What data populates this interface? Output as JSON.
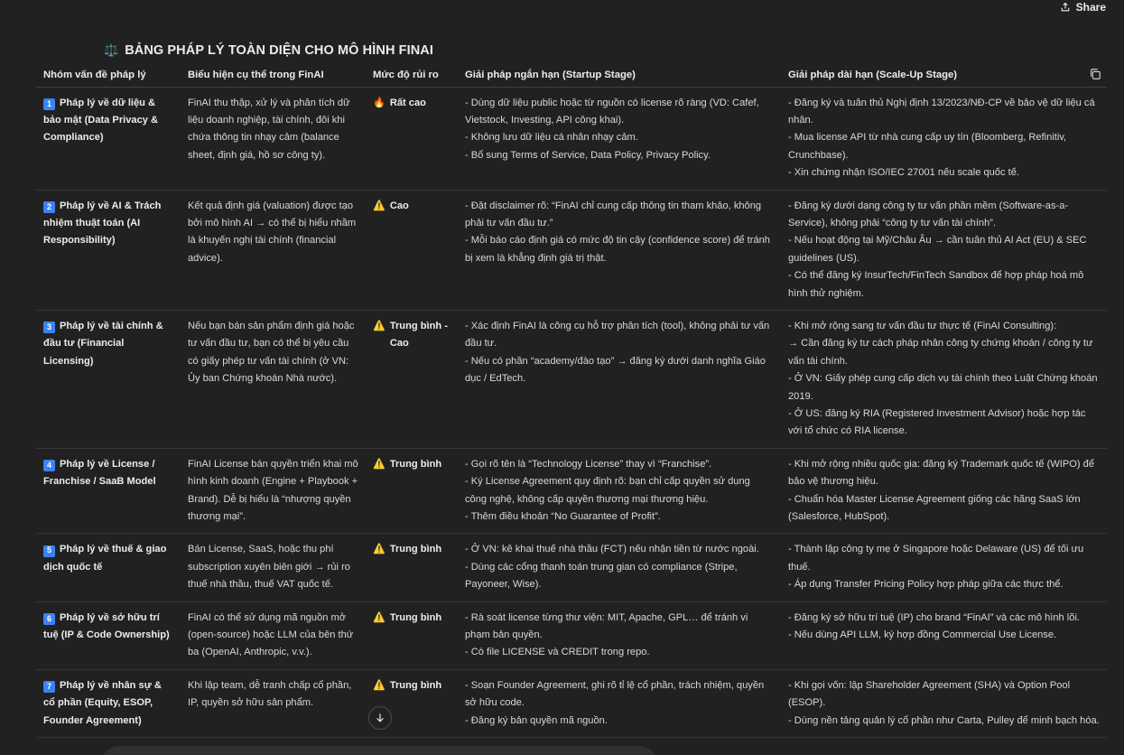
{
  "header": {
    "share_label": "Share"
  },
  "doc": {
    "title_icon": "⚖️",
    "title": "BẢNG PHÁP LÝ TOÀN DIỆN CHO MÔ HÌNH FINAI",
    "columns": [
      "Nhóm vấn đề pháp lý",
      "Biểu hiện cụ thể trong FinAI",
      "Mức độ rủi ro",
      "Giải pháp ngắn hạn (Startup Stage)",
      "Giải pháp dài hạn (Scale-Up Stage)"
    ],
    "rows": [
      {
        "num": "1",
        "issue": "Pháp lý về dữ liệu & bảo mật (Data Privacy & Compliance)",
        "desc": "FinAI thu thập, xử lý và phân tích dữ liệu doanh nghiệp, tài chính, đôi khi chứa thông tin nhạy cảm (balance sheet, định giá, hồ sơ công ty).",
        "risk_icon": "🔥",
        "risk": "Rất cao",
        "short": [
          "- Dùng dữ liệu public hoặc từ nguồn có license rõ ràng (VD: Cafef, Vietstock, Investing, API công khai).",
          "- Không lưu dữ liệu cá nhân nhạy cảm.",
          "- Bổ sung Terms of Service, Data Policy, Privacy Policy."
        ],
        "long": [
          "- Đăng ký và tuân thủ Nghị định 13/2023/NĐ-CP về bảo vệ dữ liệu cá nhân.",
          "- Mua license API từ nhà cung cấp uy tín (Bloomberg, Refinitiv, Crunchbase).",
          "- Xin chứng nhận ISO/IEC 27001 nếu scale quốc tế."
        ]
      },
      {
        "num": "2",
        "issue": "Pháp lý về AI & Trách nhiệm thuật toán (AI Responsibility)",
        "desc": "Kết quả định giá (valuation) được tạo bởi mô hình AI → có thể bị hiểu nhầm là khuyến nghị tài chính (financial advice).",
        "risk_icon": "⚠️",
        "risk": "Cao",
        "short": [
          "- Đặt disclaimer rõ: “FinAI chỉ cung cấp thông tin tham khảo, không phải tư vấn đầu tư.”",
          "- Mỗi báo cáo định giá có mức độ tin cậy (confidence score) để tránh bị xem là khẳng định giá trị thật."
        ],
        "long": [
          "- Đăng ký dưới dạng công ty tư vấn phần mềm (Software-as-a-Service), không phải “công ty tư vấn tài chính”.",
          "- Nếu hoạt động tại Mỹ/Châu Âu → cần tuân thủ AI Act (EU) & SEC guidelines (US).",
          "- Có thể đăng ký InsurTech/FinTech Sandbox để hợp pháp hoá mô hình thử nghiệm."
        ]
      },
      {
        "num": "3",
        "issue": "Pháp lý về tài chính & đầu tư (Financial Licensing)",
        "desc": "Nếu bạn bán sản phẩm định giá hoặc tư vấn đầu tư, bạn có thể bị yêu cầu có giấy phép tư vấn tài chính (ở VN: Ủy ban Chứng khoán Nhà nước).",
        "risk_icon": "⚠️",
        "risk": "Trung bình - Cao",
        "short": [
          "- Xác định FinAI là công cụ hỗ trợ phân tích (tool), không phải tư vấn đầu tư.",
          "- Nếu có phần “academy/đào tạo” → đăng ký dưới danh nghĩa Giáo dục / EdTech."
        ],
        "long": [
          "- Khi mở rộng sang tư vấn đầu tư thực tế (FinAI Consulting):",
          "→ Cần đăng ký tư cách pháp nhân công ty chứng khoán / công ty tư vấn tài chính.",
          "- Ở VN: Giấy phép cung cấp dịch vụ tài chính theo Luật Chứng khoán 2019.",
          "- Ở US: đăng ký RIA (Registered Investment Advisor) hoặc hợp tác với tổ chức có RIA license."
        ]
      },
      {
        "num": "4",
        "issue": "Pháp lý về License / Franchise / SaaB Model",
        "desc": "FinAI License bán quyền triển khai mô hình kinh doanh (Engine + Playbook + Brand). Dễ bị hiểu là “nhượng quyền thương mại”.",
        "risk_icon": "⚠️",
        "risk": "Trung bình",
        "short": [
          "- Gọi rõ tên là “Technology License” thay vì “Franchise”.",
          "- Ký License Agreement quy định rõ: bạn chỉ cấp quyền sử dụng công nghệ, không cấp quyền thương mại thương hiệu.",
          "- Thêm điều khoản “No Guarantee of Profit”."
        ],
        "long": [
          "- Khi mở rộng nhiều quốc gia: đăng ký Trademark quốc tế (WIPO) để bảo vệ thương hiệu.",
          "- Chuẩn hóa Master License Agreement giống các hãng SaaS lớn (Salesforce, HubSpot)."
        ]
      },
      {
        "num": "5",
        "issue": "Pháp lý về thuế & giao dịch quốc tế",
        "desc": "Bán License, SaaS, hoặc thu phí subscription xuyên biên giới → rủi ro thuế nhà thầu, thuế VAT quốc tế.",
        "risk_icon": "⚠️",
        "risk": "Trung bình",
        "short": [
          "- Ở VN: kê khai thuế nhà thầu (FCT) nếu nhận tiền từ nước ngoài.",
          "- Dùng các cổng thanh toán trung gian có compliance (Stripe, Payoneer, Wise)."
        ],
        "long": [
          "- Thành lập công ty mẹ ở Singapore hoặc Delaware (US) để tối ưu thuế.",
          "- Áp dụng Transfer Pricing Policy hợp pháp giữa các thực thể."
        ]
      },
      {
        "num": "6",
        "issue": "Pháp lý về sở hữu trí tuệ (IP & Code Ownership)",
        "desc": "FinAI có thể sử dụng mã nguồn mở (open-source) hoặc LLM của bên thứ ba (OpenAI, Anthropic, v.v.).",
        "risk_icon": "⚠️",
        "risk": "Trung bình",
        "short": [
          "- Rà soát license từng thư viện: MIT, Apache, GPL… để tránh vi phạm bản quyền.",
          "- Có file LICENSE và CREDIT trong repo."
        ],
        "long": [
          "- Đăng ký sở hữu trí tuệ (IP) cho brand “FinAI” và các mô hình lõi.",
          "- Nếu dùng API LLM, ký hợp đồng Commercial Use License."
        ]
      },
      {
        "num": "7",
        "issue": "Pháp lý về nhân sự & cổ phần (Equity, ESOP, Founder Agreement)",
        "desc": "Khi lập team, dễ tranh chấp cổ phần, IP, quyền sở hữu sản phẩm.",
        "risk_icon": "⚠️",
        "risk": "Trung bình",
        "short": [
          "- Soạn Founder Agreement, ghi rõ tỉ lệ cổ phần, trách nhiệm, quyền sở hữu code.",
          "- Đăng ký bản quyền mã nguồn."
        ],
        "long": [
          "- Khi gọi vốn: lập Shareholder Agreement (SHA) và Option Pool (ESOP).",
          "- Dùng nền tảng quản lý cổ phần như Carta, Pulley để minh bạch hóa."
        ]
      }
    ]
  },
  "colors": {
    "background": "#212121",
    "badge": "#3b82f6",
    "text": "#ececec"
  },
  "icons": {
    "share": "share-icon",
    "copy": "copy-icon",
    "scroll": "arrow-down-icon"
  }
}
